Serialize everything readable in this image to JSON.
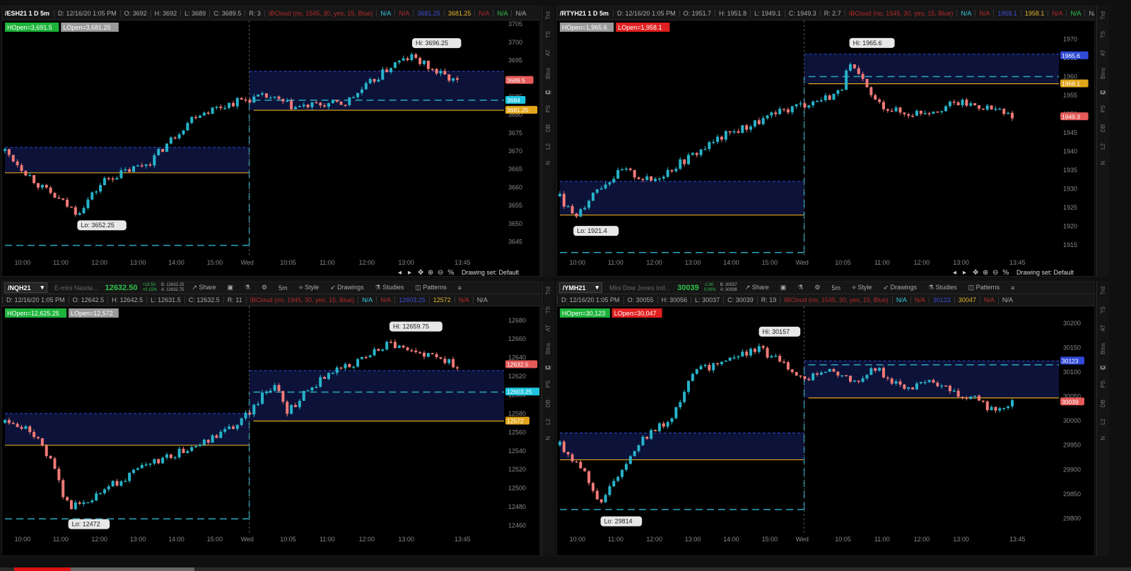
{
  "theme": {
    "up": "#27b3c9",
    "down": "#f07a78",
    "orange": "#e2a61a",
    "dash": "#2aa8bf",
    "box": "#0c1238",
    "box_dash": "#2f4ad6",
    "grid_text": "#888"
  },
  "sidebar_tabs": [
    "Trd",
    "TS",
    "AT",
    "Btns",
    "C",
    "PS",
    "DB",
    "L2",
    "N"
  ],
  "panels": [
    {
      "id": "es",
      "header": {
        "symbol": "/ESH21 1 D 5m",
        "date": "D: 12/16/20 1:05 PM",
        "open": "O: 3692",
        "high": "H: 3692",
        "low": "L: 3689",
        "close": "C: 3689.5",
        "range": "R: 3",
        "study": "IBCloud (no, 1545, 30, yes, 15, Blue)",
        "na1": "N/A",
        "na2": "N/A",
        "v1": "3681.25",
        "v2": "3681.25",
        "na3": "N/A",
        "na4": "N/A",
        "na5": "N/A"
      },
      "badges": [
        {
          "text": "HOpen=3,691.5",
          "bg": "#1db33a"
        },
        {
          "text": "LOpen=3,681.25",
          "bg": "#9a9a9a"
        }
      ],
      "price_labels": [
        {
          "text": "3689.5",
          "bg": "#e55a58",
          "price": 3689.5
        },
        {
          "text": "3684",
          "bg": "#1ec4df",
          "price": 3684
        },
        {
          "text": "3681.25",
          "bg": "#e2a61a",
          "price": 3681.25
        }
      ],
      "yaxis": {
        "min": 3641,
        "max": 3706,
        "ticks": [
          3705,
          3700,
          3695,
          3690,
          3685,
          3680,
          3675,
          3670,
          3665,
          3660,
          3655,
          3650,
          3645
        ]
      },
      "xticks": [
        "10:00",
        "11:00",
        "12:00",
        "13:00",
        "14:00",
        "15:00",
        "Wed",
        "10:05",
        "11:00",
        "12:00",
        "13:00",
        "13:45"
      ],
      "hi": {
        "text": "Hi: 3696.25",
        "price": 3696.25
      },
      "lo": {
        "text": "Lo: 3652.25",
        "price": 3652.25
      },
      "series": {
        "start": 3670,
        "low": 3652.25,
        "lowAt": 0.16,
        "preEnd": 3685,
        "mid": 3682,
        "post": 3696.25,
        "end": 3689.5,
        "pts": [
          [
            0,
            3670
          ],
          [
            0.08,
            3660
          ],
          [
            0.16,
            3653
          ],
          [
            0.22,
            3662
          ],
          [
            0.32,
            3667
          ],
          [
            0.42,
            3680
          ],
          [
            0.52,
            3684
          ],
          [
            0.58,
            3685
          ],
          [
            0.64,
            3682
          ],
          [
            0.72,
            3683
          ],
          [
            0.75,
            3683
          ],
          [
            0.78,
            3686
          ],
          [
            0.82,
            3690
          ],
          [
            0.86,
            3694
          ],
          [
            0.9,
            3696
          ],
          [
            0.95,
            3692
          ],
          [
            1,
            3689
          ]
        ]
      },
      "box": {
        "top": 3671,
        "bottom": 3664,
        "orange": 3664,
        "post_top": 3692,
        "post_bottom": 3681.25,
        "post_orange": 3681.25,
        "dash_low": 3644,
        "post_dash": 3684
      },
      "footer": {
        "drawing_set": "Drawing set: Default"
      }
    },
    {
      "id": "rty",
      "header": {
        "symbol": "/RTYH21 1 D 5m",
        "date": "D: 12/16/20 1:05 PM",
        "open": "O: 1951.7",
        "high": "H: 1951.8",
        "low": "L: 1949.1",
        "close": "C: 1949.3",
        "range": "R: 2.7",
        "study": "IBCloud (no, 1545, 30, yes, 15, Blue)",
        "na1": "N/A",
        "na2": "N/A",
        "v1": "1958.1",
        "v2": "1958.1",
        "na3": "N/A",
        "na4": "N/A",
        "na5": "N/A"
      },
      "badges": [
        {
          "text": "HOpen=1,965.6",
          "bg": "#9a9a9a"
        },
        {
          "text": "LOpen=1,958.1",
          "bg": "#e02020"
        }
      ],
      "price_labels": [
        {
          "text": "1965.6",
          "bg": "#2f4ad6",
          "price": 1965.6
        },
        {
          "text": "1958.1",
          "bg": "#e2a61a",
          "price": 1958.1
        },
        {
          "text": "1949.3",
          "bg": "#e55a58",
          "price": 1949.3
        }
      ],
      "yaxis": {
        "min": 1912,
        "max": 1975,
        "ticks": [
          1970,
          1965,
          1960,
          1955,
          1950,
          1945,
          1940,
          1935,
          1930,
          1925,
          1920,
          1915
        ]
      },
      "xticks": [
        "10:00",
        "11:00",
        "12:00",
        "13:00",
        "14:00",
        "15:00",
        "Wed",
        "10:05",
        "11:00",
        "12:00",
        "13:00",
        "13:45"
      ],
      "hi": {
        "text": "Hi: 1965.6",
        "price": 1965.6
      },
      "lo": {
        "text": "Lo: 1921.4",
        "price": 1921.4
      },
      "series": {
        "pts": [
          [
            0,
            1928
          ],
          [
            0.03,
            1922
          ],
          [
            0.08,
            1930
          ],
          [
            0.14,
            1935
          ],
          [
            0.2,
            1932
          ],
          [
            0.28,
            1938
          ],
          [
            0.36,
            1944
          ],
          [
            0.44,
            1948
          ],
          [
            0.52,
            1952
          ],
          [
            0.58,
            1954
          ],
          [
            0.62,
            1956
          ],
          [
            0.64,
            1963
          ],
          [
            0.66,
            1960
          ],
          [
            0.7,
            1953
          ],
          [
            0.76,
            1950
          ],
          [
            0.82,
            1951
          ],
          [
            0.88,
            1953
          ],
          [
            0.94,
            1952
          ],
          [
            1,
            1949
          ]
        ]
      },
      "box": {
        "top": 1932,
        "bottom": 1923,
        "orange": 1923,
        "post_top": 1966,
        "post_bottom": 1958.1,
        "post_orange": 1958.1,
        "dash_low": 1913,
        "post_dash": 1960
      },
      "footer": {
        "drawing_set": "Drawing set: Default"
      }
    },
    {
      "id": "nq",
      "header": {
        "symbol": "/NQH21",
        "desc": "E-mini Nasda...",
        "last": "12632.50",
        "chg": "+19.50",
        "pct": "+0.15%",
        "bid": "B: 12632.25",
        "ask": "A: 12632.75",
        "share": "Share",
        "style": "Style",
        "drawings": "Drawings",
        "studies": "Studies",
        "patterns": "Patterns",
        "interval": "5m"
      },
      "subhdr": {
        "date": "D: 12/16/20 1:05 PM",
        "open": "O: 12642.5",
        "high": "H: 12642.5",
        "low": "L: 12631.5",
        "close": "C: 12632.5",
        "range": "R: 11",
        "study": "IBCloud (no, 1945, 30, yes, 15, Blue)",
        "na1": "N/A",
        "na2": "N/A",
        "v1": "12603.25",
        "v2": "12572",
        "na3": "N/A",
        "na4": "N/A"
      },
      "badges": [
        {
          "text": "HOpen=12,625.25",
          "bg": "#1db33a"
        },
        {
          "text": "LOpen=12,572",
          "bg": "#9a9a9a"
        }
      ],
      "price_labels": [
        {
          "text": "12632.5",
          "bg": "#e55a58",
          "price": 12632.5
        },
        {
          "text": "12603.25",
          "bg": "#1ec4df",
          "price": 12603.25
        },
        {
          "text": "12572",
          "bg": "#e2a61a",
          "price": 12572
        }
      ],
      "yaxis": {
        "min": 12452,
        "max": 12695,
        "ticks": [
          12680,
          12660,
          12640,
          12620,
          12600,
          12580,
          12560,
          12540,
          12520,
          12500,
          12480,
          12460
        ]
      },
      "xticks": [
        "10:00",
        "11:00",
        "12:00",
        "13:00",
        "14:00",
        "15:00",
        "Wed",
        "10:05",
        "11:00",
        "12:00",
        "13:00",
        "13:45"
      ],
      "hi": {
        "text": "Hi: 12659.75",
        "price": 12659.75
      },
      "lo": {
        "text": "Lo: 12472",
        "price": 12472
      },
      "series": {
        "pts": [
          [
            0,
            12570
          ],
          [
            0.06,
            12560
          ],
          [
            0.1,
            12530
          ],
          [
            0.14,
            12480
          ],
          [
            0.2,
            12492
          ],
          [
            0.26,
            12510
          ],
          [
            0.34,
            12530
          ],
          [
            0.44,
            12548
          ],
          [
            0.52,
            12570
          ],
          [
            0.57,
            12600
          ],
          [
            0.6,
            12615
          ],
          [
            0.62,
            12580
          ],
          [
            0.66,
            12600
          ],
          [
            0.72,
            12625
          ],
          [
            0.8,
            12640
          ],
          [
            0.85,
            12656
          ],
          [
            0.9,
            12645
          ],
          [
            0.95,
            12640
          ],
          [
            1,
            12632
          ]
        ]
      },
      "box": {
        "top": 12580,
        "bottom": 12546,
        "orange": 12546,
        "post_top": 12626,
        "post_bottom": 12572,
        "post_orange": 12572,
        "dash_low": 12467,
        "post_dash": 12603
      },
      "footer": {}
    },
    {
      "id": "ym",
      "header": {
        "symbol": "/YMH21",
        "desc": "Mini Dow Jones Ind...",
        "last": "30039",
        "chg": "-2.00",
        "pct": "0.00%",
        "bid": "B: 30037",
        "ask": "A: 30038",
        "share": "Share",
        "style": "Style",
        "drawings": "Drawings",
        "studies": "Studies",
        "patterns": "Patterns",
        "interval": "5m"
      },
      "subhdr": {
        "date": "D: 12/16/20 1:05 PM",
        "open": "O: 30055",
        "high": "H: 30056",
        "low": "L: 30037",
        "close": "C: 30039",
        "range": "R: 19",
        "study": "IBCloud (no, 1545, 30, yes, 15, Blue)",
        "na1": "N/A",
        "na2": "N/A",
        "v1": "30123",
        "v2": "30047",
        "na3": "N/A",
        "na4": "N/A"
      },
      "badges": [
        {
          "text": "HOpen=30,123",
          "bg": "#1db33a"
        },
        {
          "text": "LOpen=30,047",
          "bg": "#e02020"
        }
      ],
      "price_labels": [
        {
          "text": "30123",
          "bg": "#2f4ad6",
          "price": 30123
        },
        {
          "text": "30039",
          "bg": "#e55a58",
          "price": 30039
        }
      ],
      "yaxis": {
        "min": 29770,
        "max": 30235,
        "ticks": [
          30200,
          30150,
          30100,
          30050,
          30000,
          29950,
          29900,
          29850,
          29800
        ]
      },
      "xticks": [
        "10:00",
        "11:00",
        "12:00",
        "13:00",
        "14:00",
        "15:00",
        "Wed",
        "10:05",
        "11:00",
        "12:00",
        "13:00",
        "13:45"
      ],
      "hi": {
        "text": "Hi: 30157",
        "price": 30157
      },
      "lo": {
        "text": "Lo: 29814",
        "price": 29814
      },
      "series": {
        "pts": [
          [
            0,
            29950
          ],
          [
            0.05,
            29900
          ],
          [
            0.09,
            29830
          ],
          [
            0.12,
            29880
          ],
          [
            0.18,
            29960
          ],
          [
            0.24,
            30000
          ],
          [
            0.3,
            30100
          ],
          [
            0.38,
            30130
          ],
          [
            0.44,
            30150
          ],
          [
            0.5,
            30110
          ],
          [
            0.55,
            30090
          ],
          [
            0.6,
            30110
          ],
          [
            0.65,
            30080
          ],
          [
            0.7,
            30110
          ],
          [
            0.76,
            30060
          ],
          [
            0.82,
            30080
          ],
          [
            0.88,
            30055
          ],
          [
            0.93,
            30040
          ],
          [
            0.96,
            30020
          ],
          [
            1,
            30039
          ]
        ]
      },
      "box": {
        "top": 29975,
        "bottom": 29920,
        "orange": 29920,
        "post_top": 30123,
        "post_bottom": 30047,
        "post_orange": 30047,
        "dash_low": 29818,
        "post_dash": 30115
      },
      "footer": {}
    }
  ]
}
